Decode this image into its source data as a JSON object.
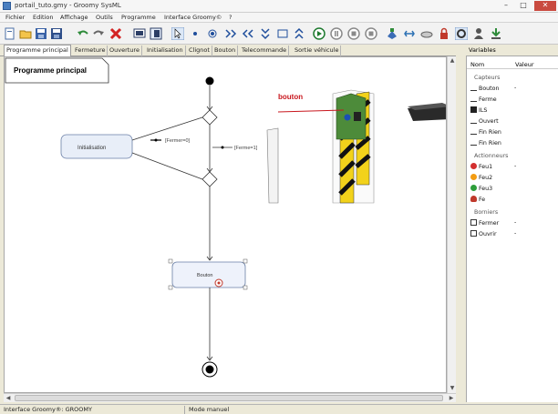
{
  "window": {
    "title": "portail_tuto.gmy - Groomy SysML",
    "minimize_label": "–",
    "maximize_label": "□",
    "close_label": "✕"
  },
  "menu": [
    "Fichier",
    "Edition",
    "Affichage",
    "Outils",
    "Programme",
    "Interface Groomy©",
    "?"
  ],
  "toolbar": {
    "icons": [
      "new-file-icon",
      "open-folder-icon",
      "save-icon",
      "save-as-icon",
      "undo-icon",
      "redo-icon",
      "delete-icon",
      "screen-icon",
      "layout-icon",
      "pointer-icon",
      "dot-icon",
      "target-icon",
      "align-left-icon",
      "align-right-icon",
      "align-top-icon",
      "align-bottom-icon",
      "play-icon",
      "pause-icon",
      "stop-icon",
      "stop2-icon",
      "robot-icon",
      "connect-icon",
      "link-icon",
      "lock-icon",
      "settings-icon",
      "user-icon",
      "download-icon"
    ]
  },
  "tabs": [
    "Programme principal",
    "Fermeture",
    "Ouverture",
    "Initialisation",
    "Clignot",
    "Bouton",
    "Telecommande",
    "Sortie véhicule"
  ],
  "diagram": {
    "title": "Programme principal",
    "initialisation_label": "Initialisation",
    "guard_fermeture": "[Fermer=0]",
    "guard_fermeture_1": "[Ferme=1]",
    "bouton_action_label": "Bouton",
    "callout_label": "bouton"
  },
  "variables": {
    "header": "Variables",
    "col_name": "Nom",
    "col_value": "Valeur",
    "groups": [
      {
        "name": "Capteurs",
        "items": [
          {
            "name": "Bouton",
            "value": "-",
            "icon": "sensor-icon"
          },
          {
            "name": "Ferme",
            "value": "",
            "icon": "sensor-icon"
          },
          {
            "name": "ILS",
            "value": "",
            "icon": "ils-icon"
          },
          {
            "name": "Ouvert",
            "value": "",
            "icon": "sensor-icon"
          },
          {
            "name": "Fin Rien",
            "value": "",
            "icon": "sensor-icon"
          },
          {
            "name": "Fin Rien",
            "value": "",
            "icon": "sensor-icon"
          }
        ]
      },
      {
        "name": "Actionneurs",
        "items": [
          {
            "name": "Feu1",
            "value": "-",
            "icon": "red-light-icon",
            "color": "#d32f2f"
          },
          {
            "name": "Feu2",
            "value": "",
            "icon": "orange-light-icon",
            "color": "#f39c12"
          },
          {
            "name": "Feu3",
            "value": "",
            "icon": "green-light-icon",
            "color": "#2e9e3a"
          },
          {
            "name": "Fe",
            "value": "",
            "icon": "bulb-icon",
            "color": "#c0392b"
          }
        ]
      },
      {
        "name": "Borniers",
        "items": [
          {
            "name": "Fermer",
            "value": "-",
            "icon": "terminal-icon"
          },
          {
            "name": "Ouvrir",
            "value": "-",
            "icon": "terminal-icon"
          }
        ]
      }
    ]
  },
  "status": {
    "left": "Interface Groomy®: GROOMY",
    "right": "Mode manuel"
  }
}
